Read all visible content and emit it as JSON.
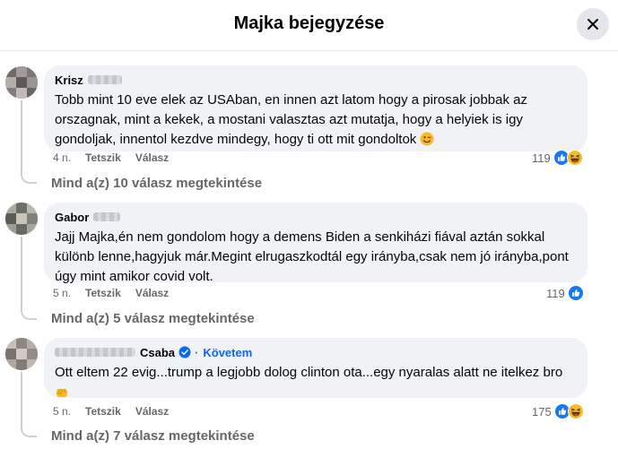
{
  "header": {
    "title": "Majka bejegyzése",
    "close_icon": "close-icon"
  },
  "comments": [
    {
      "author": "Krisz",
      "text": "Tobb mint 10 eve elek az USAban, en innen azt latom hogy a pirosak jobbak az orszagnak, mint a kekek, a mostani valasztas azt mutatja, hogy a helyiek is igy gondoljak, innentol kezdve mindegy, hogy ti ott mit gondoltok",
      "trailing_emoji": "winking-face-emoji",
      "time": "4 n.",
      "like_label": "Tetszik",
      "reply_label": "Válasz",
      "reaction_count": "119",
      "reactions": [
        "like",
        "haha"
      ],
      "view_replies": "Mind a(z) 10 válasz megtekintése"
    },
    {
      "author": "Gabor",
      "text": "Jajj Majka,én nem gondolom hogy a demens Biden a senkiházi fiával aztán sokkal különb lenne,hagyjuk már.Megint elrugaszkodtál egy irányba,csak nem jó irányba,pont úgy mint amikor covid volt.",
      "time": "5 n.",
      "like_label": "Tetszik",
      "reply_label": "Válasz",
      "reaction_count": "119",
      "reactions": [
        "like"
      ],
      "view_replies": "Mind a(z) 5 válasz megtekintése"
    },
    {
      "author": "Csaba",
      "follow_label": "Követem",
      "text": "Ott eltem 22 evig...trump a legjobb dolog clinton ota...egy nyaralas alatt ne itelkez bro",
      "trailing_emoji": "fist-emoji",
      "time": "5 n.",
      "like_label": "Tetszik",
      "reply_label": "Válasz",
      "reaction_count": "175",
      "reactions": [
        "like",
        "haha"
      ],
      "view_replies": "Mind a(z) 7 válasz megtekintése"
    }
  ],
  "colors": {
    "bubble": "#f0f2f5",
    "secondary_text": "#65676b",
    "link_blue": "#0866ff",
    "like_blue": "#1877f2",
    "haha_yellow": "#f7b928"
  }
}
